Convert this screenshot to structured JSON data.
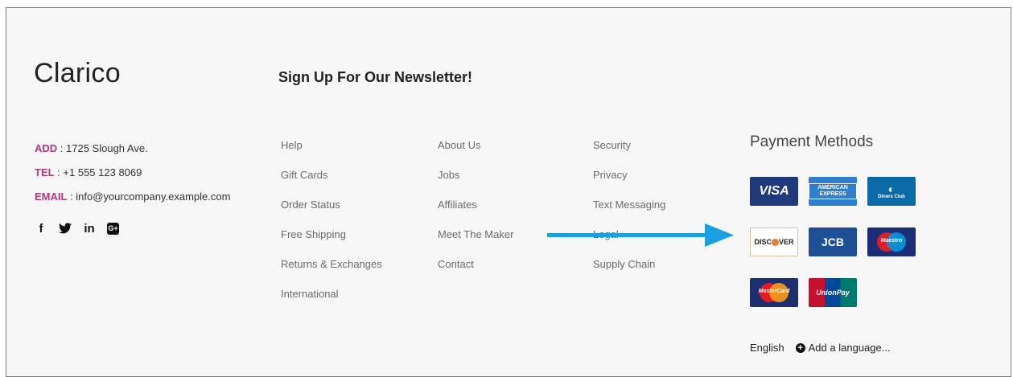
{
  "brand": "Clarico",
  "newsletter_title": "Sign Up For Our Newsletter!",
  "contact": {
    "add_label": "ADD",
    "address": "1725 Slough Ave.",
    "tel_label": "TEL",
    "phone": "+1 555 123 8069",
    "email_label": "EMAIL",
    "email": "info@yourcompany.example.com",
    "separator": " : "
  },
  "socials": {
    "facebook": "f",
    "twitter": "🐦",
    "linkedin": "in",
    "googleplus": "G+"
  },
  "links": {
    "col1": [
      "Help",
      "Gift Cards",
      "Order Status",
      "Free Shipping",
      "Returns & Exchanges",
      "International"
    ],
    "col2": [
      "About Us",
      "Jobs",
      "Affiliates",
      "Meet The Maker",
      "Contact"
    ],
    "col3": [
      "Security",
      "Privacy",
      "Text Messaging",
      "Legal",
      "Supply Chain"
    ]
  },
  "payment": {
    "title": "Payment Methods",
    "visa": "VISA",
    "amex": "AMERICAN EXPRESS",
    "diners": "Diners Club",
    "discover_a": "DISC",
    "discover_b": "VER",
    "jcb": "JCB",
    "maestro": "Maestro",
    "mastercard": "MasterCard",
    "unionpay": "UnionPay"
  },
  "language": {
    "current": "English",
    "add": "Add a language..."
  },
  "colors": {
    "label_accent": "#b1397d",
    "arrow": "#1ba1e2"
  }
}
